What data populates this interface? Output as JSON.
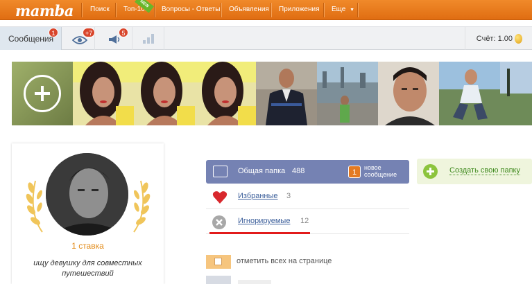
{
  "topnav": {
    "logo": "mamba",
    "items": [
      "Поиск",
      "Топ-100",
      "Вопросы - Ответы",
      "Объявления",
      "Приложения",
      "Еще"
    ],
    "new_badge": "NEW"
  },
  "subbar": {
    "messages_label": "Сообщения",
    "messages_badge": "1",
    "views_badge": "+7",
    "notify_badge": "5",
    "score_label": "Счёт: 1.00"
  },
  "profile": {
    "stakes": "1 ставка",
    "status": "ищу девушку для совместных путешествий"
  },
  "folders": {
    "main": {
      "label": "Общая папка",
      "count": "488",
      "new_count": "1",
      "new_label": "новое сообщение"
    },
    "favorites": {
      "label": "Избранные",
      "count": "3"
    },
    "ignored": {
      "label": "Игнорируемые",
      "count": "12"
    },
    "create_label": "Создать свою папку",
    "select_all_label": "отметить всех на странице"
  },
  "colors": {
    "brand_orange": "#e8781c",
    "folder_blue": "#7582b3",
    "link_blue": "#3b5e9a",
    "create_green": "#8cc43d",
    "highlight_red": "#e21b1b"
  }
}
